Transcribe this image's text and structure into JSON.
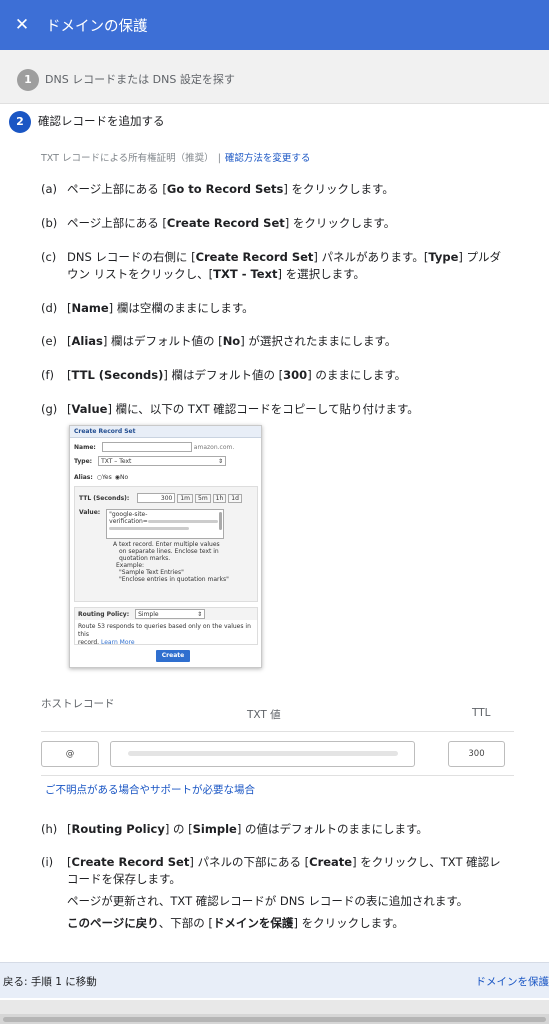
{
  "header": {
    "title": "ドメインの保護",
    "close_icon": "close-icon"
  },
  "step1": {
    "number": "1",
    "label": "DNS レコードまたは DNS 設定を探す"
  },
  "step2": {
    "number": "2",
    "label": "確認レコードを追加する"
  },
  "method": {
    "text": "TXT レコードによる所有権証明（推奨）",
    "separator": "|",
    "link": "確認方法を変更する"
  },
  "instructions": {
    "a": {
      "label": "(a)",
      "pre": "ページ上部にある [",
      "bold": "Go to Record Sets",
      "post": "] をクリックします。"
    },
    "b": {
      "label": "(b)",
      "pre": "ページ上部にある [",
      "bold": "Create Record Set",
      "post": "] をクリックします。"
    },
    "c": {
      "label": "(c)",
      "t1": "DNS レコードの右側に [",
      "b1": "Create Record Set",
      "t2": "] パネルがあります。[",
      "b2": "Type",
      "t3": "] プルダウン リストをクリックし、[",
      "b3": "TXT - Text",
      "t4": "] を選択します。"
    },
    "d": {
      "label": "(d)",
      "pre": "[",
      "bold": "Name",
      "post": "] 欄は空欄のままにします。"
    },
    "e": {
      "label": "(e)",
      "t1": "[",
      "b1": "Alias",
      "t2": "] 欄はデフォルト値の [",
      "b2": "No",
      "t3": "] が選択されたままにします。"
    },
    "f": {
      "label": "(f)",
      "t1": "[",
      "b1": "TTL (Seconds)",
      "t2": "] 欄はデフォルト値の [",
      "b2": "300",
      "t3": "] のままにします。"
    },
    "g": {
      "label": "(g)",
      "pre": "[",
      "bold": "Value",
      "post": "] 欄に、以下の TXT 確認コードをコピーして貼り付けます。"
    },
    "h": {
      "label": "(h)",
      "t1": "[",
      "b1": "Routing Policy",
      "t2": "] の [",
      "b2": "Simple",
      "t3": "] の値はデフォルトのままにします。"
    },
    "i": {
      "label": "(i)",
      "t1": "[",
      "b1": "Create Record Set",
      "t2": "] パネルの下部にある [",
      "b2": "Create",
      "t3": "] をクリックし、TXT 確認レコードを保存します。",
      "p2": "ページが更新され、TXT 確認レコードが DNS レコードの表に追加されます。",
      "p3b": "このページに戻り",
      "p3": "、下部の [",
      "p3b2": "ドメインを保護",
      "p3e": "] をクリックします。"
    }
  },
  "screenshot": {
    "title": "Create Record Set",
    "name_label": "Name:",
    "domain_suffix": "amazon.com.",
    "type_label": "Type:",
    "type_value": "TXT – Text",
    "alias_label": "Alias:",
    "alias_yes": "Yes",
    "alias_no": "No",
    "ttl_label": "TTL (Seconds):",
    "ttl_value": "300",
    "ttl_buttons": [
      "1m",
      "5m",
      "1h",
      "1d"
    ],
    "value_label": "Value:",
    "value_line1": "\"google-site-",
    "value_line2": "verification=",
    "help1": "A text record. Enter multiple values",
    "help2": "on separate lines. Enclose text in",
    "help3": "quotation marks.",
    "help4": "Example:",
    "help5": "\"Sample Text Entries\"",
    "help6": "\"Enclose entries in quotation marks\"",
    "routing_label": "Routing Policy:",
    "routing_value": "Simple",
    "routing_desc1": "Route 53 responds to queries based only on the values in this",
    "routing_desc2": "record.",
    "learn_more": "Learn More",
    "create_button": "Create"
  },
  "table": {
    "col_host": "ホストレコード",
    "col_txt": "TXT 値",
    "col_ttl": "TTL",
    "host_value": "@",
    "ttl_value": "300"
  },
  "help_link": "ご不明点がある場合やサポートが必要な場合",
  "footer": {
    "back": "戻る: 手順 1 に移動",
    "forward": "ドメインを保護"
  }
}
